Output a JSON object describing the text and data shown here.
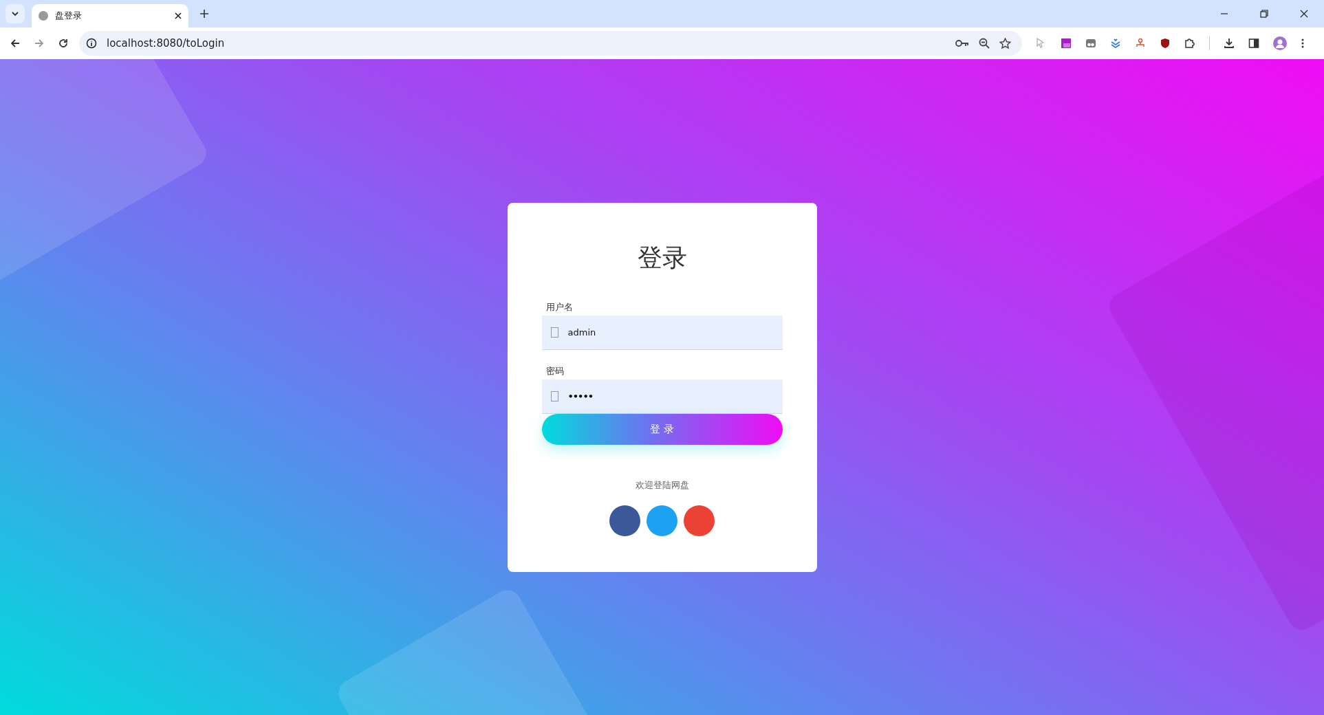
{
  "browser": {
    "tabs": [
      {
        "title": "盘登录",
        "selected": true
      }
    ],
    "address": "localhost:8080/toLogin"
  },
  "login": {
    "title": "登录",
    "fields": [
      {
        "label": "用户名",
        "value": "admin",
        "kind": "text"
      },
      {
        "label": "密码",
        "value": "•••••",
        "kind": "password"
      }
    ],
    "submit": "登 录",
    "welcome": "欢迎登陆网盘",
    "social": [
      {
        "color": "#3b5998"
      },
      {
        "color": "#1da1f2"
      },
      {
        "color": "#ea4335"
      }
    ]
  }
}
